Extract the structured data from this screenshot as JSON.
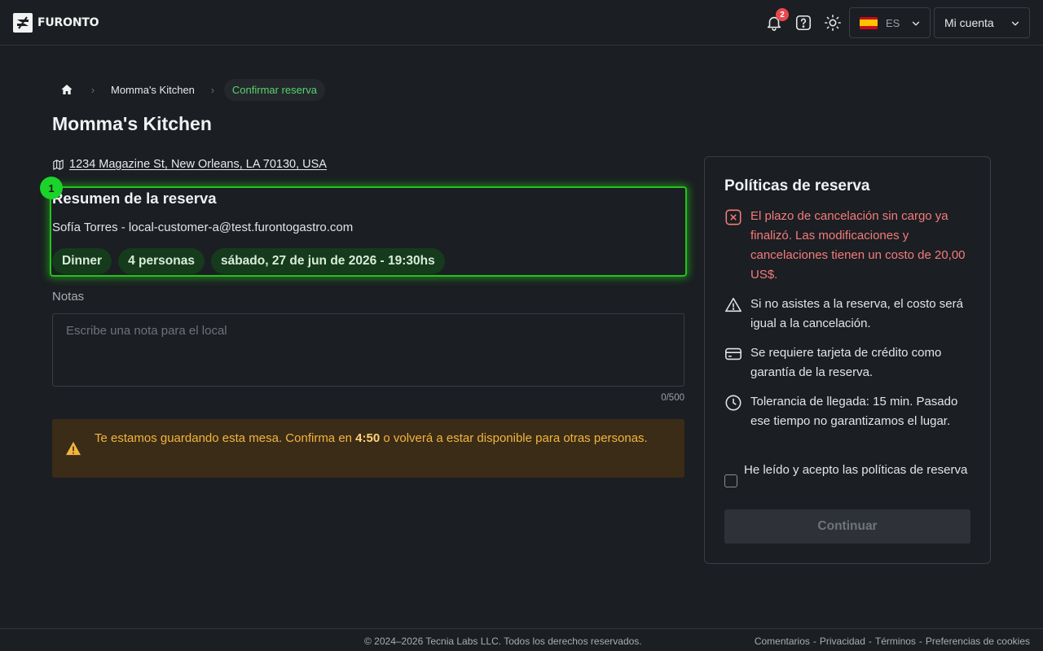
{
  "header": {
    "brand": "FURONTO",
    "notification_count": "2",
    "language": "ES",
    "account_label": "Mi cuenta"
  },
  "breadcrumb": {
    "items": [
      "Momma's Kitchen"
    ],
    "current": "Confirmar reserva"
  },
  "page": {
    "title": "Momma's Kitchen",
    "address": "1234 Magazine St, New Orleans, LA 70130, USA"
  },
  "summary": {
    "step": "1",
    "title": "Resumen de la reserva",
    "customer": "Sofía Torres - local-customer-a@test.furontogastro.com",
    "chips": [
      "Dinner",
      "4 personas",
      "sábado, 27 de jun de 2026 - 19:30hs"
    ]
  },
  "notes": {
    "label": "Notas",
    "placeholder": "Escribe una nota para el local",
    "value": "",
    "counter": "0/500"
  },
  "hold_warning": {
    "before": "Te estamos guardando esta mesa. Confirma en ",
    "time": "4:50",
    "after": " o volverá a estar disponible para otras personas."
  },
  "policies": {
    "title": "Políticas de reserva",
    "items": [
      {
        "icon": "x-square-icon",
        "text": "El plazo de cancelación sin cargo ya finalizó. Las modificaciones y cancelaciones tienen un costo de 20,00 US$."
      },
      {
        "icon": "warning-triangle-icon",
        "text": "Si no asistes a la reserva, el costo será igual a la cancelación."
      },
      {
        "icon": "credit-card-icon",
        "text": "Se requiere tarjeta de crédito como garantía de la reserva."
      },
      {
        "icon": "clock-icon",
        "text": "Tolerancia de llegada: 15 min. Pasado ese tiempo no garantizamos el lugar."
      }
    ],
    "accept_label": "He leído y acepto las políticas de reserva",
    "accept_checked": false,
    "continue_label": "Continuar"
  },
  "footer": {
    "copyright": "© 2024–2026 Tecnia Labs LLC. Todos los derechos reservados.",
    "links": [
      "Comentarios",
      "Privacidad",
      "Términos",
      "Preferencias de cookies"
    ],
    "separator": "-"
  },
  "colors": {
    "background": "#1b1e22",
    "accent_green": "#22c41a",
    "danger": "#f47c7c",
    "warning": "#f3b53f"
  }
}
